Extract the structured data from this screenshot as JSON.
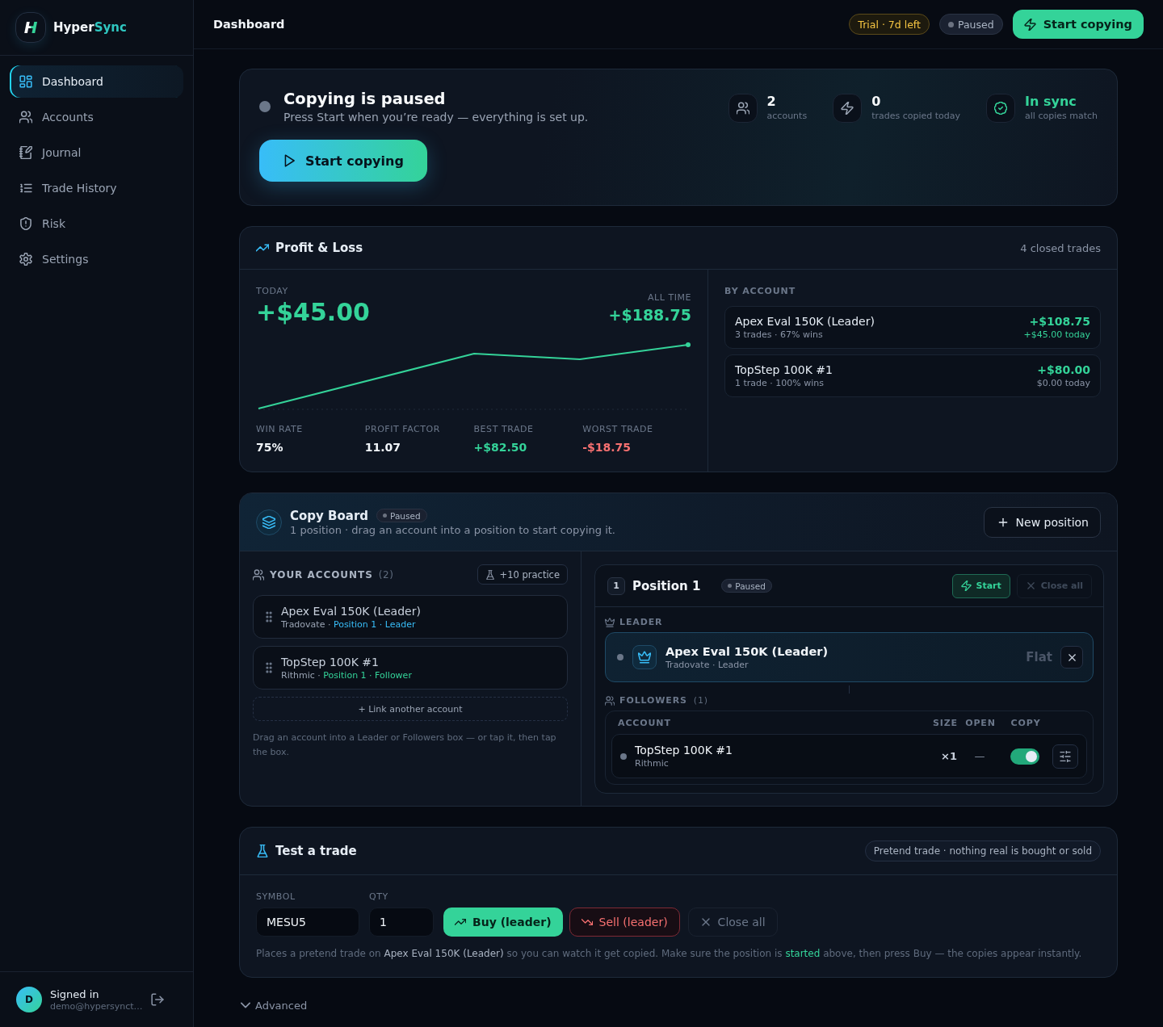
{
  "sidebar": {
    "brand": {
      "logo_letter": "H",
      "name": "Hyper",
      "name_accent": "Sync"
    },
    "nav": [
      {
        "label": "Dashboard",
        "selected": true
      },
      {
        "label": "Accounts",
        "selected": false
      },
      {
        "label": "Journal",
        "selected": false
      },
      {
        "label": "Trade History",
        "selected": false
      },
      {
        "label": "Risk",
        "selected": false
      },
      {
        "label": "Settings",
        "selected": false
      }
    ],
    "user": {
      "avatar_initial": "D",
      "status": "Signed in",
      "email": "demo@hypersynct…"
    }
  },
  "header": {
    "title": "Dashboard",
    "trial_badge": "Trial · 7d left",
    "status": {
      "label": "Paused",
      "active": false
    },
    "start_button": "Start copying"
  },
  "hero": {
    "active": false,
    "title": "Copying is paused",
    "subtitle": "Press Start when you’re ready — everything is set up.",
    "button": "Start copying",
    "stats": [
      {
        "value": "2",
        "label": "accounts",
        "kind": "count"
      },
      {
        "value": "0",
        "label": "trades copied today",
        "kind": "count"
      },
      {
        "value": "In sync",
        "label": "all copies match",
        "kind": "status"
      }
    ]
  },
  "pnl": {
    "title": "Profit & Loss",
    "summary": "4 closed trades",
    "today_label": "TODAY",
    "today_value": "+$45.00",
    "all_time_label": "ALL TIME",
    "all_time_value": "+$188.75",
    "metrics": [
      {
        "label": "WIN RATE",
        "value": "75%",
        "kind": "neutral"
      },
      {
        "label": "PROFIT FACTOR",
        "value": "11.07",
        "kind": "neutral"
      },
      {
        "label": "BEST TRADE",
        "value": "+$82.50",
        "kind": "positive"
      },
      {
        "label": "WORST TRADE",
        "value": "-$18.75",
        "kind": "negative"
      }
    ],
    "by_account_label": "BY ACCOUNT",
    "accounts": [
      {
        "name": "Apex Eval 150K (Leader)",
        "detail": "3 trades · 67% wins",
        "total": "+$108.75",
        "today": "+$45.00 today",
        "today_positive": true
      },
      {
        "name": "TopStep 100K #1",
        "detail": "1 trade · 100% wins",
        "total": "+$80.00",
        "today": "$0.00 today",
        "today_positive": false
      }
    ]
  },
  "copy_board": {
    "title": "Copy Board",
    "status": {
      "label": "Paused",
      "active": false
    },
    "subtitle": "1 position · drag an account into a position to start copying it.",
    "new_button": "New position",
    "accounts_panel": {
      "title": "YOUR ACCOUNTS",
      "count": "(2)",
      "practice_button": "+10 practice",
      "accounts": [
        {
          "name": "Apex Eval 150K (Leader)",
          "broker": "Tradovate ·",
          "assignment": "Position 1 · Leader",
          "kind": "leader"
        },
        {
          "name": "TopStep 100K #1",
          "broker": "Rithmic ·",
          "assignment": "Position 1 · Follower",
          "kind": "follower"
        }
      ],
      "link_button": "+ Link another account",
      "help": "Drag an account into a Leader or Followers box — or tap it, then tap the box."
    },
    "positions": [
      {
        "number": "1",
        "title": "Position 1",
        "status": {
          "label": "Paused",
          "active": false
        },
        "start_button": "Start",
        "close_button": {
          "label": "Close all",
          "disabled": true
        },
        "leader_label": "LEADER",
        "leader": {
          "active": false,
          "name": "Apex Eval 150K (Leader)",
          "detail": "Tradovate · Leader",
          "position": "Flat"
        },
        "followers_label": "FOLLOWERS",
        "followers_count": "(1)",
        "columns": [
          "ACCOUNT",
          "SIZE",
          "OPEN",
          "COPY"
        ],
        "followers": [
          {
            "active": false,
            "name": "TopStep 100K #1",
            "broker": "Rithmic",
            "size": "×1",
            "open": "—",
            "copy": true
          }
        ]
      }
    ]
  },
  "test_trade": {
    "title": "Test a trade",
    "note_badge": "Pretend trade · nothing real is bought or sold",
    "fields": [
      {
        "label": "SYMBOL",
        "value": "MESU5"
      },
      {
        "label": "QTY",
        "value": "1"
      }
    ],
    "buttons": [
      {
        "label": "Buy (leader)",
        "kind": "buy"
      },
      {
        "label": "Sell (leader)",
        "kind": "sell"
      },
      {
        "label": "Close all",
        "kind": "close"
      }
    ],
    "note": [
      {
        "text": "Places a pretend trade on ",
        "kind": "plain"
      },
      {
        "text": "Apex Eval 150K (Leader)",
        "kind": "account"
      },
      {
        "text": " so you can watch it get copied. Make sure the position is ",
        "kind": "plain"
      },
      {
        "text": "started",
        "kind": "highlight"
      },
      {
        "text": " above, then press Buy — the copies appear instantly.",
        "kind": "plain"
      }
    ]
  },
  "advanced": {
    "label": "Advanced",
    "expanded": false
  }
}
